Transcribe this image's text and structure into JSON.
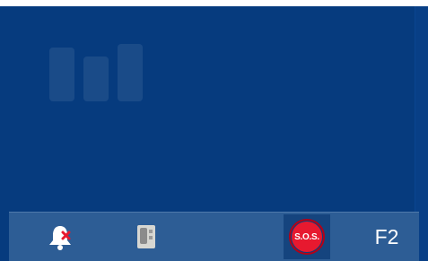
{
  "screen": {
    "background_color": "#063b7e",
    "taskbar_color": "#2d5d95",
    "taskbar": {
      "alarm_icon": "bell-with-red-x-icon",
      "intercom_icon": "handset-panel-icon",
      "sos_label": "S.O.S.",
      "sos_color": "#e7192f",
      "f2_label": "F2"
    }
  }
}
